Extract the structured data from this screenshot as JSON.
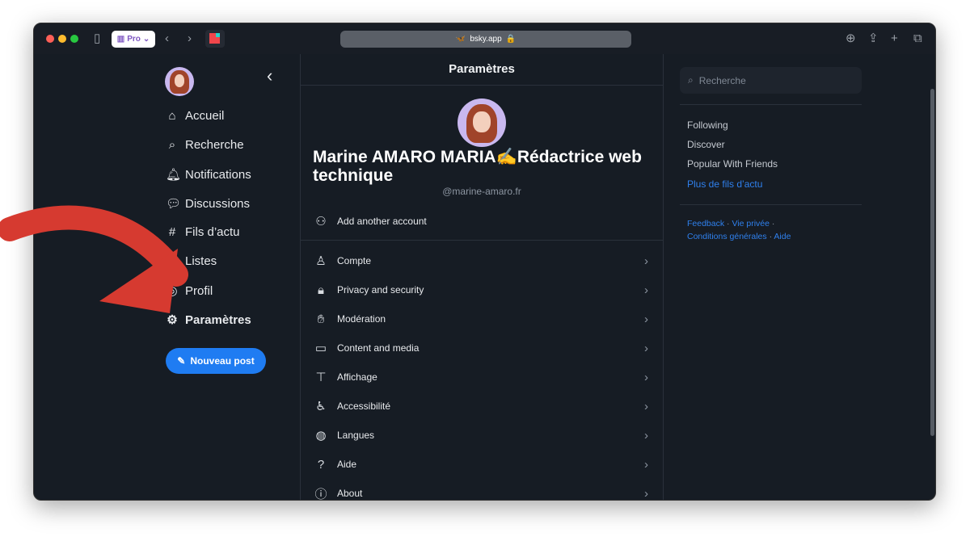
{
  "browser": {
    "profile_label": "Pro",
    "url": "bsky.app"
  },
  "sidebar": {
    "items": [
      {
        "label": "Accueil",
        "icon": "home-icon"
      },
      {
        "label": "Recherche",
        "icon": "search-icon"
      },
      {
        "label": "Notifications",
        "icon": "bell-icon"
      },
      {
        "label": "Discussions",
        "icon": "chat-icon"
      },
      {
        "label": "Fils d’actu",
        "icon": "hash-icon"
      },
      {
        "label": "Listes",
        "icon": "list-icon"
      },
      {
        "label": "Profil",
        "icon": "user-icon"
      },
      {
        "label": "Paramètres",
        "icon": "gear-icon",
        "active": true
      }
    ],
    "new_post": "Nouveau post"
  },
  "main": {
    "title": "Paramètres",
    "profile_name": "Marine AMARO MARIA✍️Rédactrice web technique ",
    "handle": "@marine-amaro.fr",
    "add_account": "Add another account",
    "items": [
      {
        "label": "Compte",
        "icon": "person-icon"
      },
      {
        "label": "Privacy and security",
        "icon": "lock-icon"
      },
      {
        "label": "Modération",
        "icon": "hand-icon"
      },
      {
        "label": "Content and media",
        "icon": "window-icon"
      },
      {
        "label": "Affichage",
        "icon": "paint-roller-icon"
      },
      {
        "label": "Accessibilité",
        "icon": "accessibility-icon"
      },
      {
        "label": "Langues",
        "icon": "globe-icon"
      },
      {
        "label": "Aide",
        "icon": "help-icon"
      },
      {
        "label": "About",
        "icon": "info-icon"
      }
    ]
  },
  "right": {
    "search_placeholder": "Recherche",
    "feeds": [
      "Following",
      "Discover",
      "Popular With Friends"
    ],
    "more_feeds": "Plus de fils d’actu",
    "footer": {
      "feedback": "Feedback",
      "privacy": "Vie privée",
      "terms": "Conditions générales",
      "help": "Aide"
    }
  },
  "colors": {
    "accent": "#1f7cf2",
    "background": "#161c24",
    "annotation_arrow": "#d63a30"
  }
}
